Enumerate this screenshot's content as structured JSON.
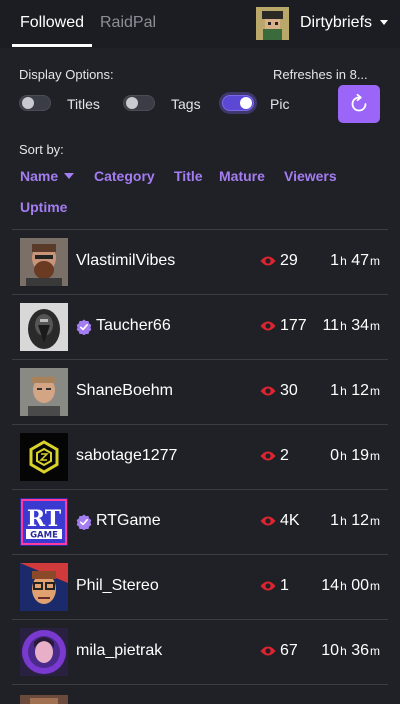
{
  "header": {
    "tabs": [
      {
        "label": "Followed",
        "active": true
      },
      {
        "label": "RaidPal",
        "active": false
      }
    ],
    "user": {
      "name": "Dirtybriefs"
    }
  },
  "options": {
    "display_label": "Display Options:",
    "refresh_label": "Refreshes in   8...",
    "toggles": [
      {
        "label": "Titles",
        "on": false
      },
      {
        "label": "Tags",
        "on": false
      },
      {
        "label": "Pic",
        "on": true
      }
    ]
  },
  "sort": {
    "label": "Sort by:",
    "items": [
      "Name",
      "Category",
      "Title",
      "Mature",
      "Viewers",
      "Uptime"
    ],
    "active": "Name"
  },
  "streams": [
    {
      "name": "VlastimilVibes",
      "verified": false,
      "viewers": "29",
      "hours": "1",
      "minutes": "47",
      "avatar": "bearded-man"
    },
    {
      "name": "Taucher66",
      "verified": true,
      "viewers": "177",
      "hours": "11",
      "minutes": "34",
      "avatar": "diver-helmet"
    },
    {
      "name": "ShaneBoehm",
      "verified": false,
      "viewers": "30",
      "hours": "1",
      "minutes": "12",
      "avatar": "man-portrait"
    },
    {
      "name": "sabotage1277",
      "verified": false,
      "viewers": "2",
      "hours": "0",
      "minutes": "19",
      "avatar": "hex-logo"
    },
    {
      "name": "RTGame",
      "verified": true,
      "viewers": "4K",
      "hours": "1",
      "minutes": "12",
      "avatar": "rt-game-logo"
    },
    {
      "name": "Phil_Stereo",
      "verified": false,
      "viewers": "1",
      "hours": "14",
      "minutes": "00",
      "avatar": "glasses-portrait"
    },
    {
      "name": "mila_pietrak",
      "verified": false,
      "viewers": "67",
      "hours": "10",
      "minutes": "36",
      "avatar": "purple-portrait"
    }
  ],
  "units": {
    "h": "h",
    "m": "m"
  },
  "colors": {
    "accent": "#9b66f7",
    "viewer_eye": "#e0242f",
    "verified": "#a47df0",
    "background": "#1f2127"
  }
}
